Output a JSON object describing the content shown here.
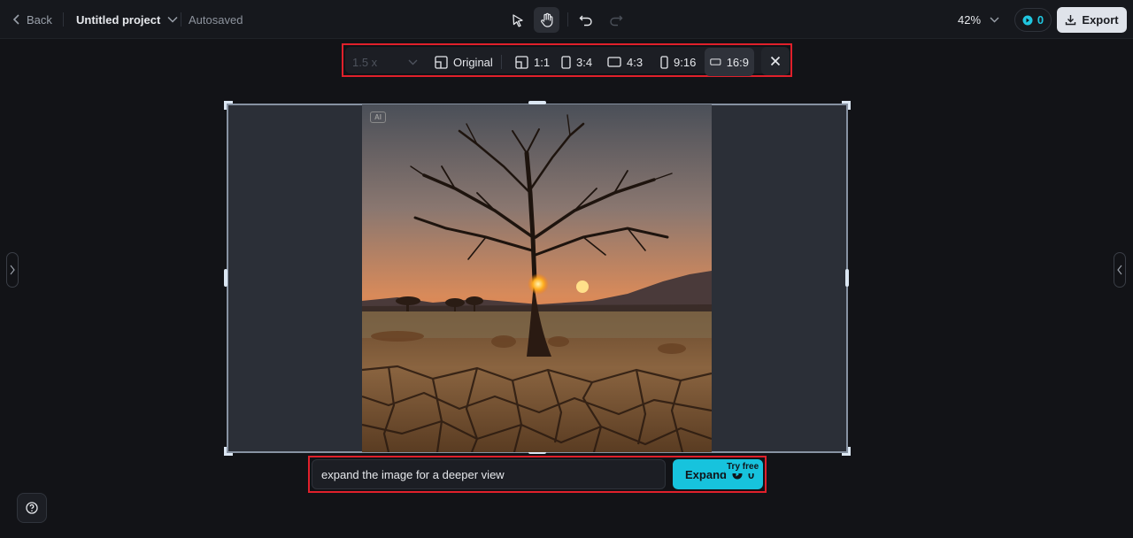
{
  "header": {
    "back_label": "Back",
    "project_title": "Untitled project",
    "autosave_status": "Autosaved",
    "zoom_level": "42%",
    "credits": "0",
    "export_label": "Export"
  },
  "ratio_toolbar": {
    "scale_value": "1.5 x",
    "options": [
      {
        "label": "Original",
        "icon": "original-ratio-icon"
      },
      {
        "label": "1:1",
        "icon": "square-ratio-icon"
      },
      {
        "label": "3:4",
        "icon": "portrait-ratio-icon"
      },
      {
        "label": "4:3",
        "icon": "landscape-ratio-icon"
      },
      {
        "label": "9:16",
        "icon": "tall-ratio-icon"
      },
      {
        "label": "16:9",
        "icon": "wide-ratio-icon"
      }
    ],
    "selected": "16:9"
  },
  "canvas": {
    "ai_badge": "AI"
  },
  "prompt": {
    "value": "expand the image for a deeper view",
    "expand_label": "Expand",
    "expand_cost": "0",
    "try_free_label": "Try free"
  },
  "colors": {
    "accent": "#17c3dd",
    "highlight_border": "#e0202b",
    "background": "#121317"
  }
}
